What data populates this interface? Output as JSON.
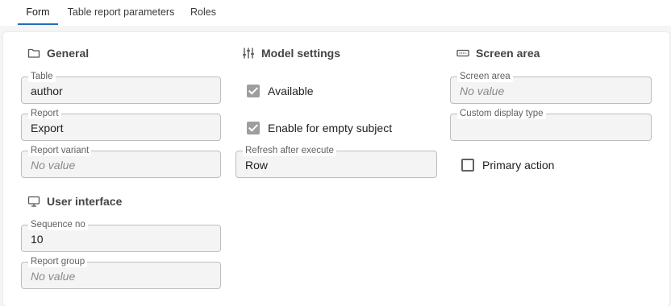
{
  "tabs": [
    {
      "label": "Form",
      "active": true
    },
    {
      "label": "Table report parameters",
      "active": false
    },
    {
      "label": "Roles",
      "active": false
    }
  ],
  "sections": {
    "general": {
      "title": "General",
      "icon": "folder-icon"
    },
    "model_settings": {
      "title": "Model settings",
      "icon": "sliders-icon"
    },
    "screen_area": {
      "title": "Screen area",
      "icon": "keyboard-icon"
    },
    "user_interface": {
      "title": "User interface",
      "icon": "monitor-icon"
    }
  },
  "fields": {
    "table": {
      "label": "Table",
      "value": "author"
    },
    "report": {
      "label": "Report",
      "value": "Export"
    },
    "report_variant": {
      "label": "Report variant",
      "value": "No value"
    },
    "refresh_after_execute": {
      "label": "Refresh after execute",
      "value": "Row"
    },
    "screen_area": {
      "label": "Screen area",
      "value": "No value"
    },
    "custom_display_type": {
      "label": "Custom display type",
      "value": ""
    },
    "sequence_no": {
      "label": "Sequence no",
      "value": "10"
    },
    "report_group": {
      "label": "Report group",
      "value": "No value"
    }
  },
  "checkboxes": {
    "available": {
      "label": "Available",
      "checked": true
    },
    "enable_empty_subject": {
      "label": "Enable for empty subject",
      "checked": true
    },
    "primary_action": {
      "label": "Primary action",
      "checked": false
    }
  },
  "colors": {
    "accent": "#1f6fb8",
    "checkbox_checked": "#9e9e9e"
  }
}
